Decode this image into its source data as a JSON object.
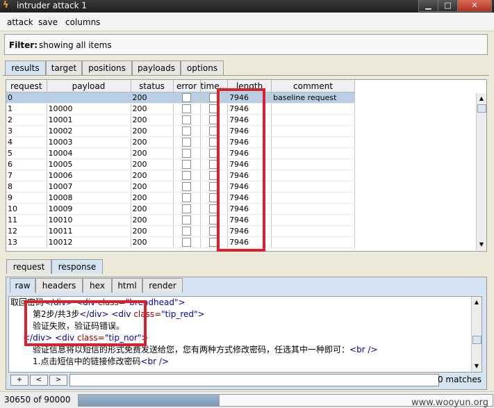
{
  "window": {
    "title": "intruder attack 1",
    "minimize": "▁",
    "maximize": "□",
    "close": "✕"
  },
  "menu": [
    "attack",
    "save",
    "columns"
  ],
  "filter": {
    "label": "Filter:",
    "text": "showing all items"
  },
  "tabs": [
    "results",
    "target",
    "positions",
    "payloads",
    "options"
  ],
  "table": {
    "columns": [
      "request",
      "payload",
      "status",
      "error",
      "time...",
      "length",
      "comment"
    ],
    "rows": [
      {
        "request": "0",
        "payload": "",
        "status": "200",
        "length": "7946",
        "comment": "baseline request"
      },
      {
        "request": "1",
        "payload": "10000",
        "status": "200",
        "length": "7946",
        "comment": ""
      },
      {
        "request": "2",
        "payload": "10001",
        "status": "200",
        "length": "7946",
        "comment": ""
      },
      {
        "request": "3",
        "payload": "10002",
        "status": "200",
        "length": "7946",
        "comment": ""
      },
      {
        "request": "4",
        "payload": "10003",
        "status": "200",
        "length": "7946",
        "comment": ""
      },
      {
        "request": "5",
        "payload": "10004",
        "status": "200",
        "length": "7946",
        "comment": ""
      },
      {
        "request": "6",
        "payload": "10005",
        "status": "200",
        "length": "7946",
        "comment": ""
      },
      {
        "request": "7",
        "payload": "10006",
        "status": "200",
        "length": "7946",
        "comment": ""
      },
      {
        "request": "8",
        "payload": "10007",
        "status": "200",
        "length": "7946",
        "comment": ""
      },
      {
        "request": "9",
        "payload": "10008",
        "status": "200",
        "length": "7946",
        "comment": ""
      },
      {
        "request": "10",
        "payload": "10009",
        "status": "200",
        "length": "7946",
        "comment": ""
      },
      {
        "request": "11",
        "payload": "10010",
        "status": "200",
        "length": "7946",
        "comment": ""
      },
      {
        "request": "12",
        "payload": "10011",
        "status": "200",
        "length": "7946",
        "comment": ""
      },
      {
        "request": "13",
        "payload": "10012",
        "status": "200",
        "length": "7946",
        "comment": ""
      }
    ]
  },
  "detail_tabs": [
    "request",
    "response"
  ],
  "view_tabs": [
    "raw",
    "headers",
    "hex",
    "html",
    "render"
  ],
  "response_body": {
    "l1_text": "取回密码",
    "l1_tag1": "</div>",
    "l1_tag2": "<div",
    "l1_attr": "class=",
    "l1_val": "\"breadhead\"",
    "l1_close": ">",
    "l2_text": "第2步/共3步",
    "l2_tag1": "</div>",
    "l2_tag2": "<div",
    "l2_attr": "class=",
    "l2_val": "\"tip_red\"",
    "l2_close": ">",
    "l3_text": "验证失败，验证码错误。",
    "l4_tag1": "</div>",
    "l4_tag2": "<div",
    "l4_attr": "class=",
    "l4_val": "\"tip_nor\"",
    "l4_close": ">",
    "l5_text": "验证信息将以短信的形式免费发送给您，您有两种方式修改密码，任选其中一种即可：",
    "l5_tag": "<br />",
    "l6_text": "1.点击短信中的链接修改密码",
    "l6_tag": "<br />"
  },
  "search": {
    "btn_plus": "+",
    "btn_prev": "<",
    "btn_next": ">",
    "value": "",
    "matches": "0 matches"
  },
  "status": {
    "count": "30650 of 90000",
    "progress_fraction": 0.34
  },
  "watermark": "www.wooyun.org"
}
